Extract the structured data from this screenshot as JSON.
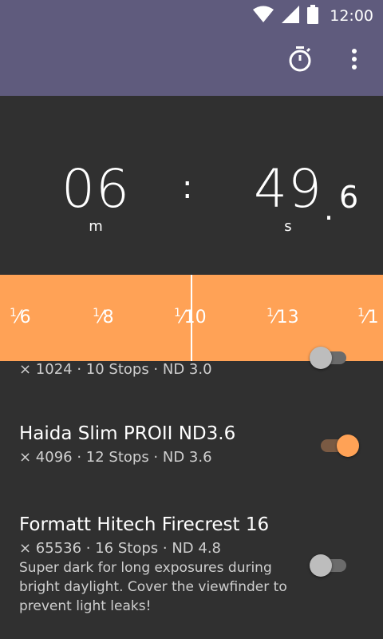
{
  "status_bar": {
    "time": "12:00",
    "icons": [
      "wifi-icon",
      "signal-icon",
      "battery-icon"
    ]
  },
  "app_bar": {
    "actions": [
      "timer-icon",
      "overflow-menu-icon"
    ],
    "color": "#5f5b7d"
  },
  "timer": {
    "minutes": "06",
    "minutes_unit": "m",
    "colon": ":",
    "seconds": "49",
    "dot": ".",
    "fraction": "6",
    "seconds_unit": "s"
  },
  "ruler": {
    "accent": "#ffa256",
    "ticks": [
      {
        "num": "1",
        "den": "6"
      },
      {
        "num": "1",
        "den": "8"
      },
      {
        "num": "1",
        "den": "10"
      },
      {
        "num": "1",
        "den": "13"
      },
      {
        "num": "1",
        "den": "1"
      }
    ]
  },
  "filters": [
    {
      "title": "",
      "subtitle": "× 1024  ·  10 Stops  ·  ND 3.0",
      "enabled": false
    },
    {
      "title": "Haida Slim PROII ND3.6",
      "subtitle": "× 4096  ·  12 Stops  ·  ND 3.6",
      "enabled": true
    },
    {
      "title": "Formatt Hitech Firecrest 16",
      "subtitle": "× 65536  ·  16 Stops  ·  ND 4.8",
      "description": "Super dark for long exposures during bright daylight. Cover the viewfinder to prevent light leaks!",
      "enabled": false
    }
  ]
}
